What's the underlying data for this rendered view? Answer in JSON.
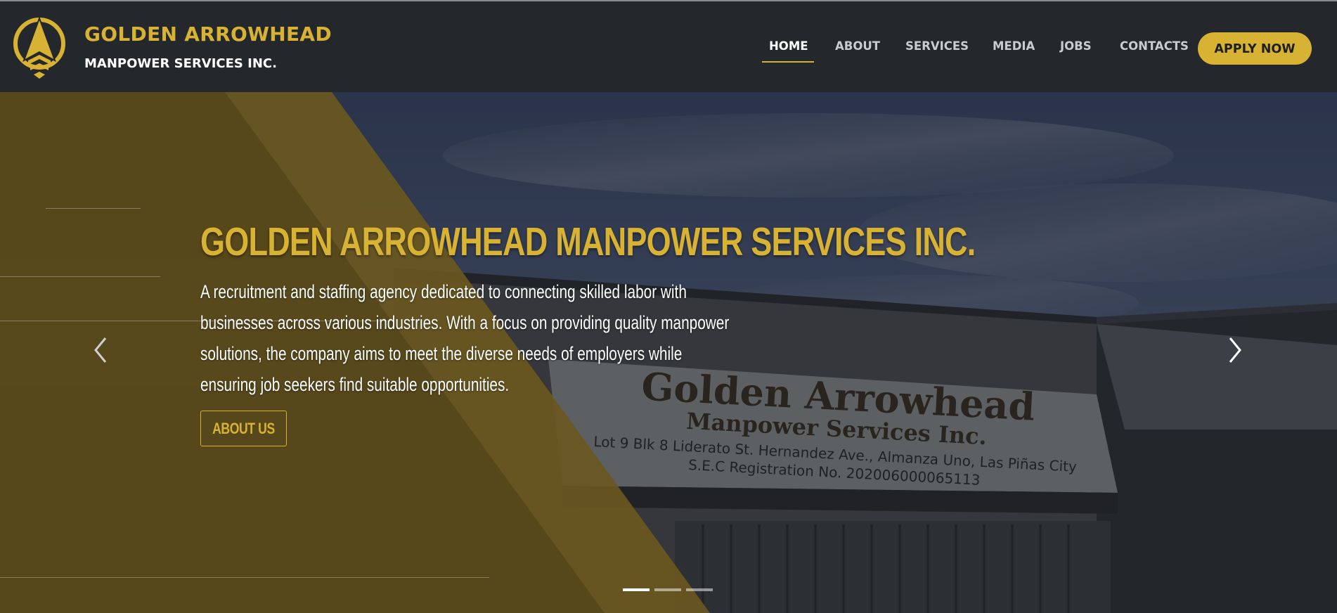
{
  "header": {
    "brand_name": "GOLDEN ARROWHEAD",
    "brand_sub": "MANPOWER SERVICES INC.",
    "logo_icon": "arrowhead-logo-icon",
    "nav": [
      {
        "label": "HOME",
        "active": true
      },
      {
        "label": "ABOUT",
        "active": false
      },
      {
        "label": "SERVICES",
        "active": false
      },
      {
        "label": "MEDIA",
        "active": false
      },
      {
        "label": "JOBS",
        "active": false
      },
      {
        "label": "CONTACTS",
        "active": false
      }
    ],
    "apply_label": "APPLY NOW"
  },
  "hero": {
    "title": "GOLDEN ARROWHEAD MANPOWER SERVICES INC.",
    "description": "A recruitment and staffing agency dedicated to connecting skilled labor with businesses across various industries. With a focus on providing quality manpower solutions, the company aims to meet the diverse needs of employers while ensuring job seekers find suitable opportunities.",
    "button_label": "ABOUT US",
    "prev_icon": "chevron-left-icon",
    "next_icon": "chevron-right-icon",
    "slides_total": 3,
    "active_slide": 1,
    "photo_sign": {
      "line1": "Golden Arrowhead",
      "line2": "Manpower Services Inc.",
      "line3": "Lot 9 Blk 8 Liderato St. Hernandez Ave., Almanza Uno, Las Piñas City",
      "line4": "S.E.C Registration No. 202006000065113"
    }
  },
  "colors": {
    "accent": "#d8b232",
    "header_bg": "#24272c",
    "overlay": "#5b4a14"
  }
}
